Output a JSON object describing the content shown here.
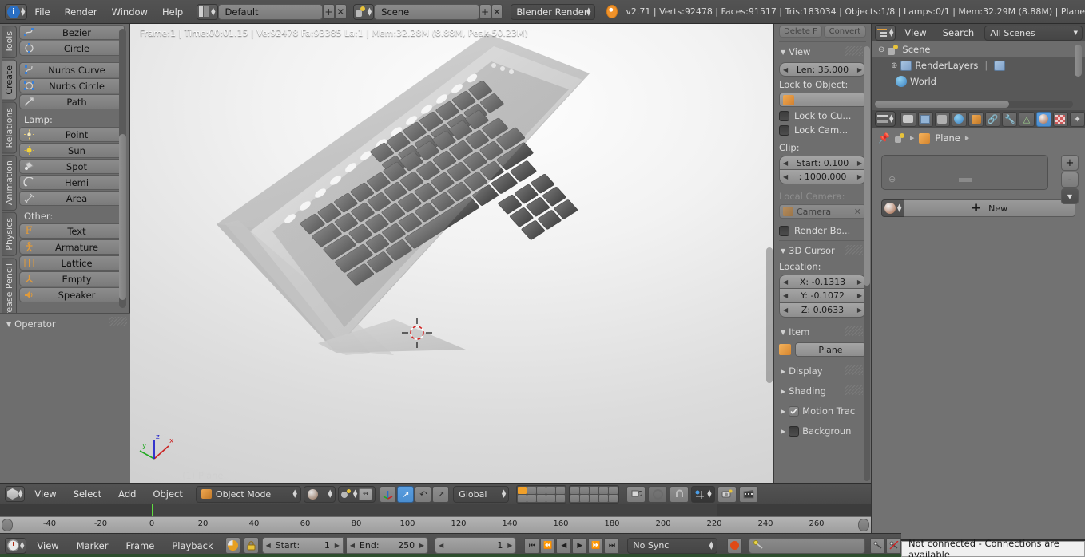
{
  "app": {
    "title": "Blender",
    "version": "v2.71"
  },
  "top_header": {
    "editor_icon": "info-editor-icon",
    "menus": [
      "File",
      "Render",
      "Window",
      "Help"
    ],
    "screen_layout": {
      "icon": "screen-layout-icon",
      "value": "Default",
      "add": "+",
      "remove": "x"
    },
    "scene": {
      "icon": "scene-icon",
      "value": "Scene",
      "add": "+",
      "remove": "x"
    },
    "render_engine": "Blender Render",
    "blender_logo": "blender-logo-icon",
    "stats": "v2.71 | Verts:92478 | Faces:91517 | Tris:183034 | Objects:1/8 | Lamps:0/1 | Mem:32.29M (8.88M) | Plane"
  },
  "left_panel": {
    "tabs": [
      {
        "label": "Tools",
        "active": false
      },
      {
        "label": "Create",
        "active": true
      },
      {
        "label": "Relations",
        "active": false
      },
      {
        "label": "Animation",
        "active": false
      },
      {
        "label": "Physics",
        "active": false
      },
      {
        "label": "Grease Pencil",
        "active": false
      }
    ],
    "groups": [
      {
        "label": "",
        "items": [
          {
            "label": "Bezier",
            "icon": "bezier-curve-icon"
          },
          {
            "label": "Circle",
            "icon": "bezier-circle-icon"
          }
        ]
      },
      {
        "label": "",
        "items": [
          {
            "label": "Nurbs Curve",
            "icon": "nurbs-curve-icon"
          },
          {
            "label": "Nurbs Circle",
            "icon": "nurbs-circle-icon"
          },
          {
            "label": "Path",
            "icon": "path-icon"
          }
        ]
      },
      {
        "label": "Lamp:",
        "items": [
          {
            "label": "Point",
            "icon": "lamp-point-icon"
          },
          {
            "label": "Sun",
            "icon": "lamp-sun-icon"
          },
          {
            "label": "Spot",
            "icon": "lamp-spot-icon"
          },
          {
            "label": "Hemi",
            "icon": "lamp-hemi-icon"
          },
          {
            "label": "Area",
            "icon": "lamp-area-icon"
          }
        ]
      },
      {
        "label": "Other:",
        "items": [
          {
            "label": "Text",
            "icon": "text-icon"
          },
          {
            "label": "Armature",
            "icon": "armature-icon"
          },
          {
            "label": "Lattice",
            "icon": "lattice-icon"
          },
          {
            "label": "Empty",
            "icon": "empty-axis-icon"
          },
          {
            "label": "Speaker",
            "icon": "speaker-icon"
          }
        ]
      }
    ],
    "operator_panel": {
      "label": "Operator",
      "collapsed": false
    }
  },
  "viewport": {
    "stats": "Frame:1 | Time:00:01.15 | Ve:92478 Fa:93385 La:1 | Mem:32.28M (8.88M, Peak 50.23M)",
    "object_label": "(1) Plane",
    "axis_labels": {
      "x": "x",
      "y": "y",
      "z": "z"
    },
    "axis_colors": {
      "x": "#cc2222",
      "y": "#22aa22",
      "z": "#2222cc"
    },
    "cursor_color": "#d02020",
    "model": "keyboard-3d-model"
  },
  "n_panel": {
    "top_partial_buttons": [
      "Delete F",
      "Convert"
    ],
    "view": {
      "title": "View",
      "lens": "Len: 35.000",
      "lock_to_object_label": "Lock to Object:",
      "lock_object_value": "",
      "lock_to_cursor": {
        "label": "Lock to Cu...",
        "checked": false
      },
      "lock_camera": {
        "label": "Lock Cam...",
        "checked": false
      },
      "clip_label": "Clip:",
      "clip_start": "Start: 0.100",
      "clip_end": ": 1000.000",
      "local_camera_label": "Local Camera:",
      "local_camera_value": "Camera",
      "render_border": {
        "label": "Render Bo...",
        "checked": false
      }
    },
    "cursor": {
      "title": "3D Cursor",
      "location_label": "Location:",
      "x": "X:  -0.1313",
      "y": "Y:  -0.1072",
      "z": "Z:   0.0633"
    },
    "item": {
      "title": "Item",
      "object_name": "Plane",
      "icon": "object-mesh-icon"
    },
    "collapsed_panels": [
      {
        "title": "Display",
        "checkbox": null
      },
      {
        "title": "Shading",
        "checkbox": null
      },
      {
        "title": "Motion Trac",
        "checkbox": true
      },
      {
        "title": "Backgroun",
        "checkbox": false
      }
    ]
  },
  "outliner": {
    "editor_icon": "outliner-icon",
    "menus": [
      "View",
      "Search"
    ],
    "display_mode": "All Scenes",
    "tree": [
      {
        "label": "Scene",
        "icon": "scene-icon",
        "depth": 0,
        "expander": "-",
        "selected": true
      },
      {
        "label": "RenderLayers",
        "icon": "renderlayers-icon",
        "depth": 1,
        "expander": "+",
        "selected": false
      },
      {
        "label": "World",
        "icon": "world-icon",
        "depth": 1,
        "expander": "",
        "selected": false
      }
    ]
  },
  "properties": {
    "editor_icon": "properties-icon",
    "tabs": [
      {
        "name": "render-tab",
        "icon": "camera-back-icon",
        "active": false
      },
      {
        "name": "render-layers-tab",
        "icon": "images-icon",
        "active": false
      },
      {
        "name": "scene-tab",
        "icon": "scene-icon",
        "active": false
      },
      {
        "name": "world-tab",
        "icon": "world-icon",
        "active": false
      },
      {
        "name": "object-tab",
        "icon": "cube-icon",
        "active": false
      },
      {
        "name": "constraints-tab",
        "icon": "chain-icon",
        "active": false
      },
      {
        "name": "modifiers-tab",
        "icon": "wrench-icon",
        "active": false
      },
      {
        "name": "data-tab",
        "icon": "triangle-mesh-icon",
        "active": false
      },
      {
        "name": "material-tab",
        "icon": "material-sphere-icon",
        "active": true
      },
      {
        "name": "texture-tab",
        "icon": "checker-icon",
        "active": false
      },
      {
        "name": "particles-tab",
        "icon": "particles-icon",
        "active": false
      }
    ],
    "breadcrumb": {
      "pin": "pin-icon",
      "scene": "scene-icon",
      "object": "Plane"
    },
    "material_slots": [],
    "slot_buttons": [
      "+",
      "-",
      "v"
    ],
    "new_material_button": "New",
    "browse_icon": "material-browse-icon"
  },
  "vp_header": {
    "editor_icon": "3dview-icon",
    "menus": [
      "View",
      "Select",
      "Add",
      "Object"
    ],
    "mode": "Object Mode",
    "viewport_shading": "solid-shading-icon",
    "pivot": "pivot-median-icon",
    "manipulator_toggle": true,
    "transform_widgets": [
      "translate-widget-icon",
      "rotate-widget-icon",
      "scale-widget-icon"
    ],
    "orientation": "Global",
    "layers_row1": [
      true,
      false,
      false,
      false,
      false,
      false,
      false,
      false,
      false,
      false
    ],
    "layers_row2": [
      false,
      false,
      false,
      false,
      false,
      false,
      false,
      false,
      false,
      false
    ],
    "extra_buttons": [
      "lock-object-modes-icon",
      "proportional-edit-icon",
      "snap-magnet-icon",
      "snap-element-icon",
      "render-opengl-icon",
      "render-opengl-anim-icon"
    ]
  },
  "timeline": {
    "editor_icon": "timeline-icon",
    "menus": [
      "View",
      "Marker",
      "Frame",
      "Playback"
    ],
    "autokey_icon": "record-autokey-icon",
    "lock_icon": "lock-icon",
    "start": "Start:",
    "start_value": "1",
    "end": "End:",
    "end_value": "250",
    "current_frame": "1",
    "playback_buttons": [
      "jump-start-icon",
      "play-reverse-icon",
      "play-back-icon",
      "play-forward-icon",
      "step-forward-icon",
      "jump-end-icon"
    ],
    "sync_mode": "No Sync",
    "record_button": "record-icon",
    "keying_set_icon": "keyingset-icon",
    "keying_set_value": "",
    "ruler_ticks": [
      -40,
      -20,
      0,
      20,
      40,
      60,
      80,
      100,
      120,
      140,
      160,
      180,
      200,
      220,
      240,
      260
    ],
    "playhead_frame": 1,
    "frame_range_start": -53,
    "frame_range_end": 276
  },
  "status_bar": {
    "message": "Not connected - Connections are available"
  },
  "colors": {
    "header_bg": "#4b4b4b",
    "panel_bg": "#6e6e6e",
    "properties_bg": "#727272",
    "accent_blue": "#4a8ed0",
    "accent_orange": "#f0a02a",
    "playhead_green": "#5fdc40",
    "record_red": "#e04a16"
  }
}
